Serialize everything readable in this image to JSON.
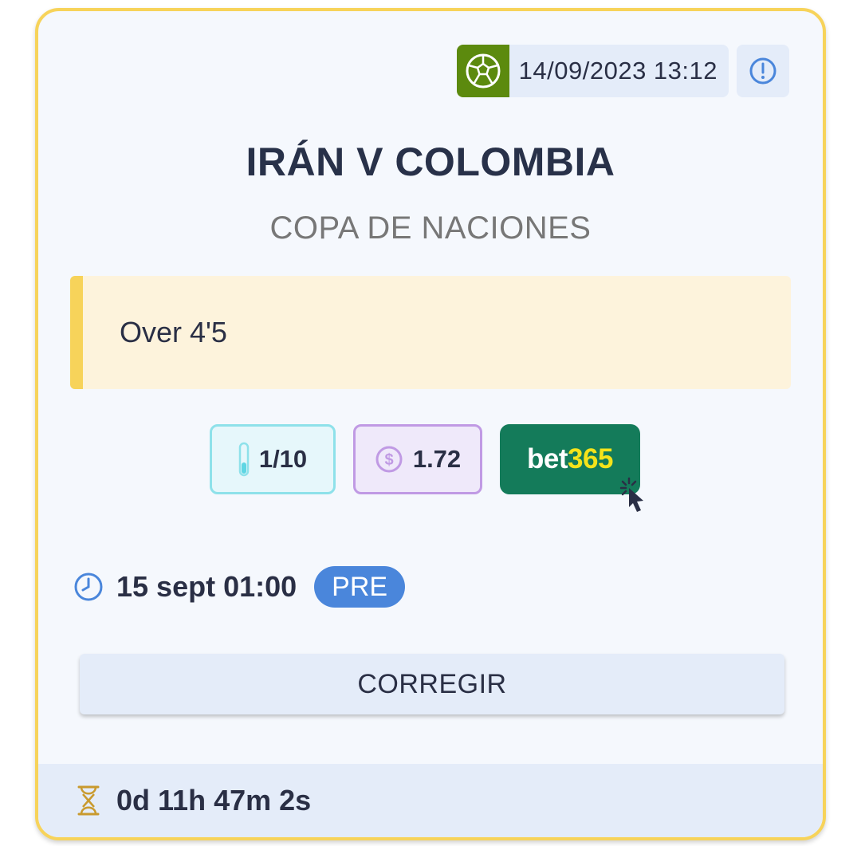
{
  "header": {
    "sport_icon": "soccer-ball-icon",
    "datetime": "14/09/2023 13:12",
    "info_icon": "exclamation-circle-icon"
  },
  "match": {
    "title": "IRÁN V COLOMBIA",
    "competition": "COPA DE NACIONES"
  },
  "pick": {
    "text": "Over 4'5"
  },
  "badges": {
    "stake": "1/10",
    "odds": "1.72",
    "bookmaker_bet": "bet",
    "bookmaker_num": "365"
  },
  "schedule": {
    "time": "15 sept 01:00",
    "status": "PRE"
  },
  "actions": {
    "correct_label": "CORREGIR"
  },
  "footer": {
    "countdown": "0d 11h 47m 2s"
  },
  "colors": {
    "card_border": "#f7d35a",
    "sport_bg": "#5c8a0e",
    "status_pill": "#4a86db",
    "bookmaker_bg": "#147b5a",
    "bookmaker_accent": "#f5e31a"
  }
}
